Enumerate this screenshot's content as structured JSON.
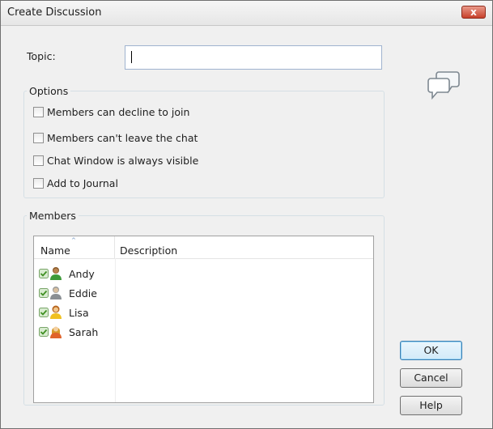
{
  "window": {
    "title": "Create Discussion",
    "close_glyph": "x"
  },
  "topic": {
    "label": "Topic:",
    "value": ""
  },
  "options": {
    "legend": "Options",
    "checkboxes": [
      {
        "label": "Members can decline to join",
        "checked": false
      },
      {
        "label": "Members can't leave the chat",
        "checked": false
      },
      {
        "label": "Chat Window is always visible",
        "checked": false
      },
      {
        "label": "Add to Journal",
        "checked": false
      }
    ]
  },
  "members": {
    "legend": "Members",
    "columns": {
      "name": "Name",
      "description": "Description"
    },
    "sort_indicator": "^",
    "rows": [
      {
        "name": "Andy",
        "description": "",
        "checked": true,
        "icon": "user-green-icon"
      },
      {
        "name": "Eddie",
        "description": "",
        "checked": true,
        "icon": "user-gray-icon"
      },
      {
        "name": "Lisa",
        "description": "",
        "checked": true,
        "icon": "user-yellow-icon"
      },
      {
        "name": "Sarah",
        "description": "",
        "checked": true,
        "icon": "user-orange-icon"
      }
    ]
  },
  "buttons": {
    "ok": "OK",
    "cancel": "Cancel",
    "help": "Help"
  },
  "colors": {
    "accent": "#3c7fb1",
    "close": "#c7402b",
    "check": "#5aaa3a"
  }
}
